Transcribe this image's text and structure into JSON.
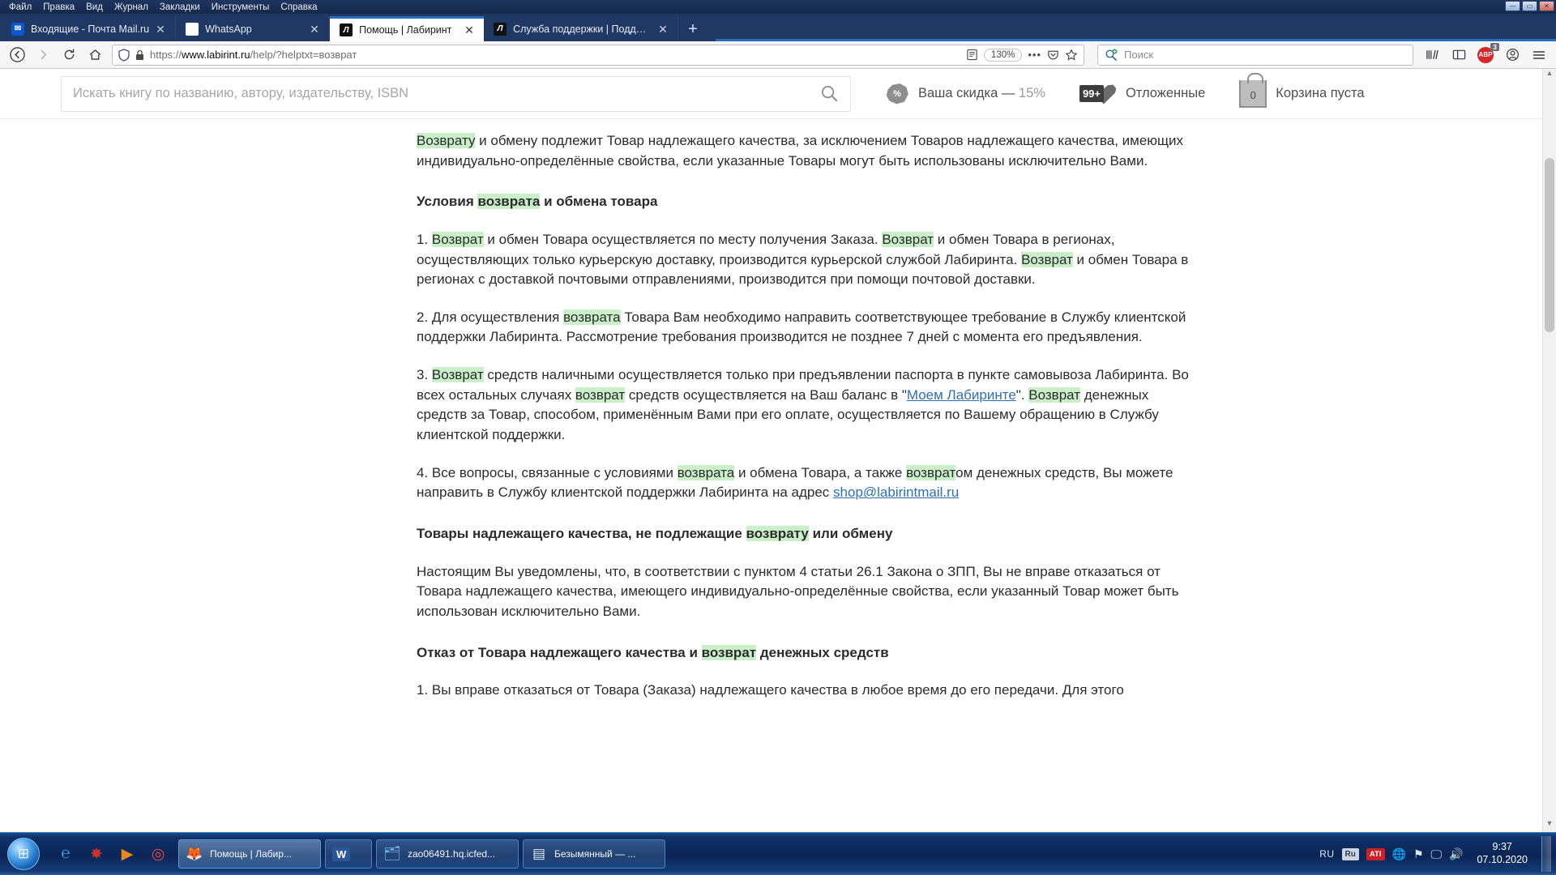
{
  "window": {
    "menus": [
      "Файл",
      "Правка",
      "Вид",
      "Журнал",
      "Закладки",
      "Инструменты",
      "Справка"
    ],
    "controls": {
      "minimize": "—",
      "maximize": "▭",
      "close": "✕"
    }
  },
  "tabs": [
    {
      "title": "Входящие - Почта Mail.ru",
      "favicon": "mail-icon",
      "active": false
    },
    {
      "title": "WhatsApp",
      "favicon": "whatsapp-icon",
      "active": false
    },
    {
      "title": "Помощь | Лабиринт",
      "favicon": "labirint-icon",
      "active": true
    },
    {
      "title": "Служба поддержки | Поддер...",
      "favicon": "labirint-icon",
      "active": false
    }
  ],
  "newtab_label": "+",
  "navbar": {
    "back": "back-icon",
    "forward": "forward-icon",
    "reload": "reload-icon",
    "home": "home-icon",
    "url_scheme": "https://",
    "url_host": "www.labirint.ru",
    "url_path": "/help/?helptxt=возврат",
    "zoom_level": "130%",
    "reader_icon": "reader-view-icon",
    "menu_dots": "•••",
    "pocket_icon": "pocket-icon",
    "bookmark_icon": "star-icon",
    "search_placeholder": "Поиск",
    "library_icon": "library-icon",
    "sidebar_icon": "sidebar-icon",
    "adblock_label": "ABP",
    "adblock_badge": "3",
    "account_icon": "account-icon",
    "hamburger_icon": "hamburger-menu-icon"
  },
  "site": {
    "search_placeholder": "Искать книгу по названию, автору, издательству, ISBN",
    "discount_label": "Ваша скидка — ",
    "discount_value": "15%",
    "deferred_count": "99+",
    "deferred_label": "Отложенные",
    "cart_count": "0",
    "cart_label": "Корзина пуста"
  },
  "article": {
    "p1_a": "Возврату",
    "p1_b": " и обмену подлежит Товар надлежащего качества, за исключением Товаров надлежащего качества, имеющих индивидуально-определённые свойства, если указанные Товары могут быть использованы исключительно Вами.",
    "h1_a": "Условия ",
    "h1_hl": "возврата",
    "h1_b": " и обмена товара",
    "p2_1": "1. ",
    "p2_hl1": "Возврат",
    "p2_2": " и обмен Товара осуществляется по месту получения Заказа. ",
    "p2_hl2": "Возврат",
    "p2_3": " и обмен Товара в регионах, осуществляющих только курьерскую доставку, производится курьерской службой Лабиринта. ",
    "p2_hl3": "Возврат",
    "p2_4": " и обмен Товара в регионах с доставкой почтовыми отправлениями, производится при помощи почтовой доставки.",
    "p3_1": "2. Для осуществления ",
    "p3_hl1": "возврата",
    "p3_2": " Товара Вам необходимо направить соответствующее требование в Службу клиентской поддержки Лабиринта. Рассмотрение требования производится не позднее 7 дней с момента его предъявления.",
    "p4_1": "3. ",
    "p4_hl1": "Возврат",
    "p4_2": " средств наличными осуществляется только при предъявлении паспорта в пункте самовывоза Лабиринта. Во всех остальных случаях ",
    "p4_hl2": "возврат",
    "p4_3": " средств осуществляется на Ваш баланс в \"",
    "p4_link": "Моем Лабиринте",
    "p4_4": "\". ",
    "p4_hl3": "Возврат",
    "p4_5": " денежных средств за Товар, способом, применённым Вами при его оплате, осуществляется по Вашему обращению в Службу клиентской поддержки.",
    "p5_1": "4. Все вопросы, связанные с условиями ",
    "p5_hl1": "возврата",
    "p5_2": " и обмена Товара, а также ",
    "p5_hl2": "возврат",
    "p5_3": "ом денежных средств, Вы можете направить в Службу клиентской поддержки Лабиринта на адрес ",
    "p5_link": "shop@labirintmail.ru",
    "h2_a": "Товары надлежащего качества, не подлежащие ",
    "h2_hl": "возврату",
    "h2_b": " или обмену",
    "p6": "Настоящим Вы уведомлены, что, в соответствии с пунктом 4 статьи 26.1 Закона о ЗПП, Вы не вправе отказаться от Товара надлежащего качества, имеющего индивидуально-определённые свойства, если указанный Товар может быть использован исключительно Вами.",
    "h3_a": "Отказ от Товара надлежащего качества и ",
    "h3_hl": "возврат",
    "h3_b": " денежных средств",
    "p7": "1. Вы вправе отказаться от Товара (Заказа) надлежащего качества в любое время до его передачи. Для этого"
  },
  "taskbar": {
    "start_icon": "windows-start-icon",
    "quicklaunch": [
      {
        "name": "internet-explorer-icon",
        "glyph": "℮"
      },
      {
        "name": "foxit-reader-icon",
        "glyph": "🦊"
      },
      {
        "name": "media-player-icon",
        "glyph": "▶"
      },
      {
        "name": "opera-icon",
        "glyph": "◎"
      }
    ],
    "tasks": [
      {
        "label": "Помощь | Лабир...",
        "icon": "firefox-icon",
        "active": true
      },
      {
        "label": "",
        "icon": "word-icon",
        "active": false
      },
      {
        "label": "zao06491.hq.icfed...",
        "icon": "folder-icon",
        "active": false
      },
      {
        "label": "Безымянный — ...",
        "icon": "notepad-icon",
        "active": false
      }
    ],
    "tray": {
      "language": "RU",
      "ru_badge": "Ru",
      "ati_badge": "ATI",
      "network_icon": "network-secure-icon",
      "flag_icon": "action-center-icon",
      "monitor_icon": "display-icon",
      "volume_icon": "volume-icon",
      "time": "9:37",
      "date": "07.10.2020"
    }
  }
}
